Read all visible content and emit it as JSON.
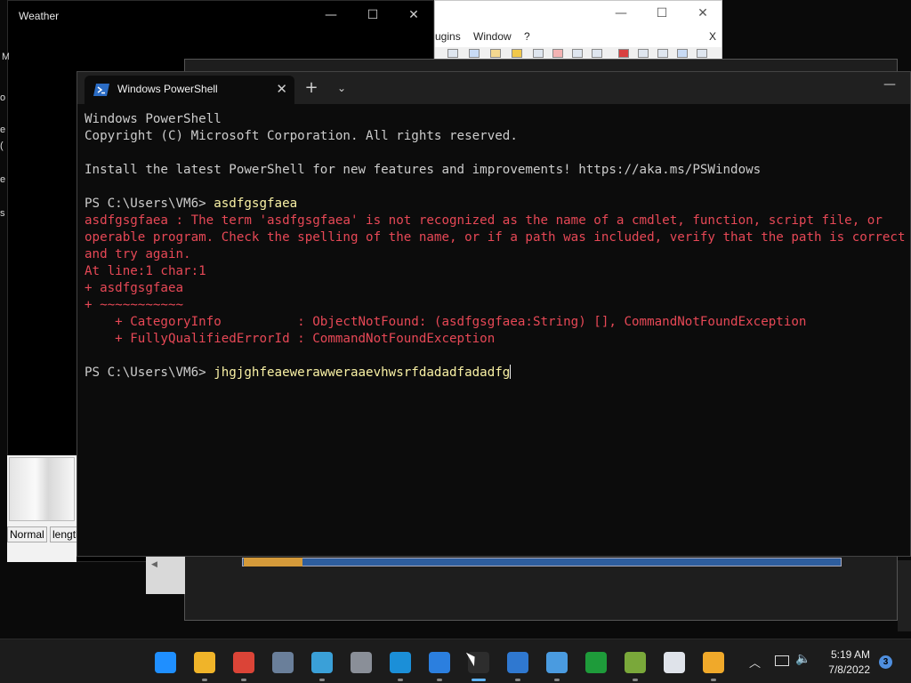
{
  "weather_window": {
    "title": "Weather",
    "left_snippets": [
      "M",
      "o",
      "e",
      "(",
      "e",
      "s"
    ]
  },
  "editor_window": {
    "menu": [
      "ugins",
      "Window",
      "?"
    ],
    "close_x": "X"
  },
  "left_panel": {
    "status_items": [
      "Normal",
      "length"
    ]
  },
  "terminal": {
    "tab_title": "Windows PowerShell",
    "tab_close": "✕",
    "new_tab": "+",
    "tab_dropdown": "⌄",
    "minimize": "—",
    "lines": [
      {
        "text": "Windows PowerShell",
        "kind": "normal"
      },
      {
        "text": "Copyright (C) Microsoft Corporation. All rights reserved.",
        "kind": "normal"
      },
      {
        "text": "",
        "kind": "normal"
      },
      {
        "text": "Install the latest PowerShell for new features and improvements! https://aka.ms/PSWindows",
        "kind": "normal"
      },
      {
        "text": "",
        "kind": "normal"
      },
      {
        "prompt": "PS C:\\Users\\VM6> ",
        "command": "asdfgsgfaea",
        "kind": "prompt"
      },
      {
        "text": "asdfgsgfaea : The term 'asdfgsgfaea' is not recognized as the name of a cmdlet, function, script file, or",
        "kind": "error"
      },
      {
        "text": "operable program. Check the spelling of the name, or if a path was included, verify that the path is correct",
        "kind": "error"
      },
      {
        "text": "and try again.",
        "kind": "error"
      },
      {
        "text": "At line:1 char:1",
        "kind": "error"
      },
      {
        "text": "+ asdfgsgfaea",
        "kind": "error"
      },
      {
        "text": "+ ~~~~~~~~~~~",
        "kind": "error"
      },
      {
        "text": "    + CategoryInfo          : ObjectNotFound: (asdfgsgfaea:String) [], CommandNotFoundException",
        "kind": "error"
      },
      {
        "text": "    + FullyQualifiedErrorId : CommandNotFoundException",
        "kind": "error"
      },
      {
        "text": "",
        "kind": "normal"
      },
      {
        "prompt": "PS C:\\Users\\VM6> ",
        "command": "jhgjghfeaewerawweraaevhwsrfdadadfadadfg",
        "kind": "prompt",
        "cursor": true
      }
    ],
    "colors": {
      "error": "#e74856",
      "command": "#f9f1a5",
      "text": "#cccccc",
      "background": "#0c0c0c"
    }
  },
  "taskbar": {
    "apps": [
      {
        "name": "start-icon",
        "color": "#1f8fff"
      },
      {
        "name": "file-explorer-icon",
        "color": "#f0b429"
      },
      {
        "name": "chrome-icon",
        "color": "#db4437"
      },
      {
        "name": "calculator-icon",
        "color": "#6a7f9a"
      },
      {
        "name": "network-globe-icon",
        "color": "#3aa0d8"
      },
      {
        "name": "settings-icon",
        "color": "#8a8f98"
      },
      {
        "name": "edge-icon",
        "color": "#1b8fd8"
      },
      {
        "name": "calendar-icon",
        "color": "#2b7fdf"
      },
      {
        "name": "terminal-icon",
        "color": "#2d2d2d"
      },
      {
        "name": "phone-icon",
        "color": "#2f78d0"
      },
      {
        "name": "notepad-icon",
        "color": "#4a9be0"
      },
      {
        "name": "xbox-icon",
        "color": "#1e9b3a"
      },
      {
        "name": "chart-app-icon",
        "color": "#7aa83a"
      },
      {
        "name": "cards-game-icon",
        "color": "#dfe3ea"
      },
      {
        "name": "weather-app-icon",
        "color": "#f0a92a"
      }
    ],
    "clock_time": "5:19 AM",
    "clock_date": "7/8/2022",
    "notification_count": "3"
  }
}
